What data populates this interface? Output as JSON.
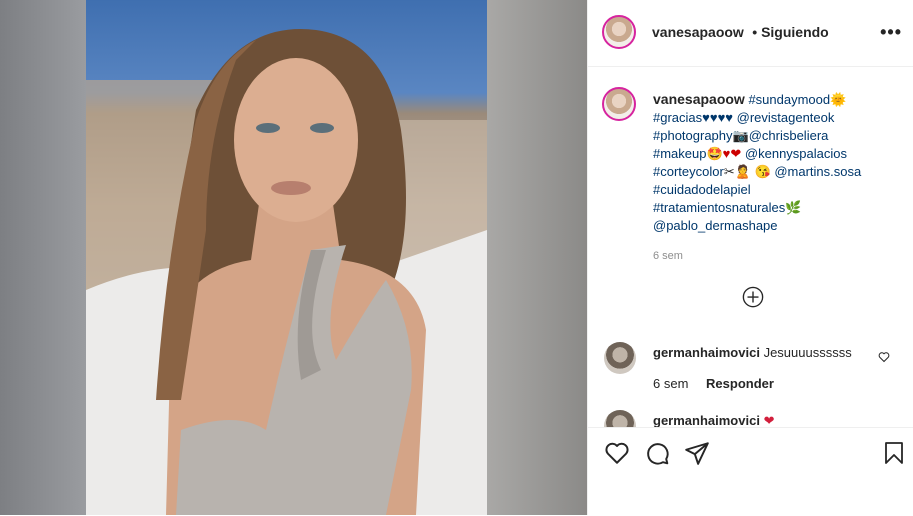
{
  "post": {
    "username": "vanesapaoow",
    "follow_status": "• Siguiendo",
    "more_label": "•••",
    "caption_lines": [
      {
        "pre": "",
        "tags": "#sundaymood",
        "emoji": "🌞"
      },
      {
        "tags": "#gracias",
        "emoji": "♥♥♥♥",
        "mention": " @revistagenteok"
      },
      {
        "tags": "#photography",
        "emoji": "📷",
        "mention": "@chrisbeliera"
      },
      {
        "tags": "#makeup",
        "emoji": "🤩♥❤",
        "mention": " @kennyspalacios"
      },
      {
        "tags": "#corteycolor",
        "emoji": "✂🙎 😘",
        "mention": " @martins.sosa"
      },
      {
        "tags": "#cuidadodelapiel",
        "emoji": "",
        "mention": ""
      },
      {
        "tags": "#tratamientosnaturales",
        "emoji": "🌿",
        "mention": ""
      },
      {
        "tags": "",
        "emoji": "",
        "mention": "@pablo_dermashape"
      }
    ],
    "caption_time": "6 sem"
  },
  "comments": [
    {
      "user": "germanhaimovici",
      "text": "Jesuuuussssss",
      "time": "6 sem",
      "reply": "Responder"
    },
    {
      "user": "germanhaimovici",
      "text": "❤"
    }
  ],
  "icons": {
    "like": "heart-icon",
    "comment": "comment-icon",
    "share": "share-icon",
    "save": "bookmark-icon",
    "load_more": "plus-circle-icon"
  }
}
